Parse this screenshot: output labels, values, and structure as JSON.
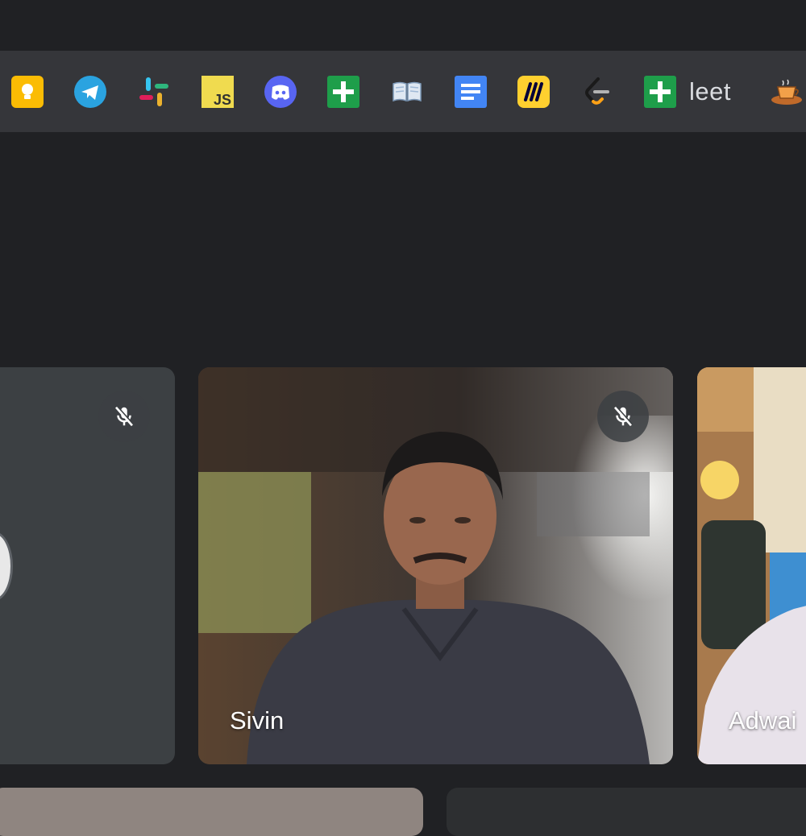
{
  "bookmarks": [
    {
      "icon": "keep-icon",
      "color": "#fbbc04"
    },
    {
      "icon": "telegram-icon",
      "color": "#2aa3e0"
    },
    {
      "icon": "slack-icon",
      "color": "#e01e5a"
    },
    {
      "icon": "javascript-icon",
      "color": "#f0db4f"
    },
    {
      "icon": "discord-icon",
      "color": "#5865f2"
    },
    {
      "icon": "google-sheets-plus-icon",
      "color": "#1e9e4a"
    },
    {
      "icon": "book-icon",
      "color": "#9fb9d6"
    },
    {
      "icon": "google-docs-icon",
      "color": "#4285f4"
    },
    {
      "icon": "miro-icon",
      "color": "#ffd02f"
    },
    {
      "icon": "leetcode-icon",
      "color": "#ffa116"
    },
    {
      "icon": "google-sheets-plus-icon",
      "color": "#1e9e4a",
      "label": "leet"
    },
    {
      "icon": "cup-icon",
      "color": "#e38a2b"
    }
  ],
  "participants": [
    {
      "name": "",
      "muted": true
    },
    {
      "name": "Sivin",
      "muted": true
    },
    {
      "name": "Adwai",
      "muted": false
    }
  ]
}
